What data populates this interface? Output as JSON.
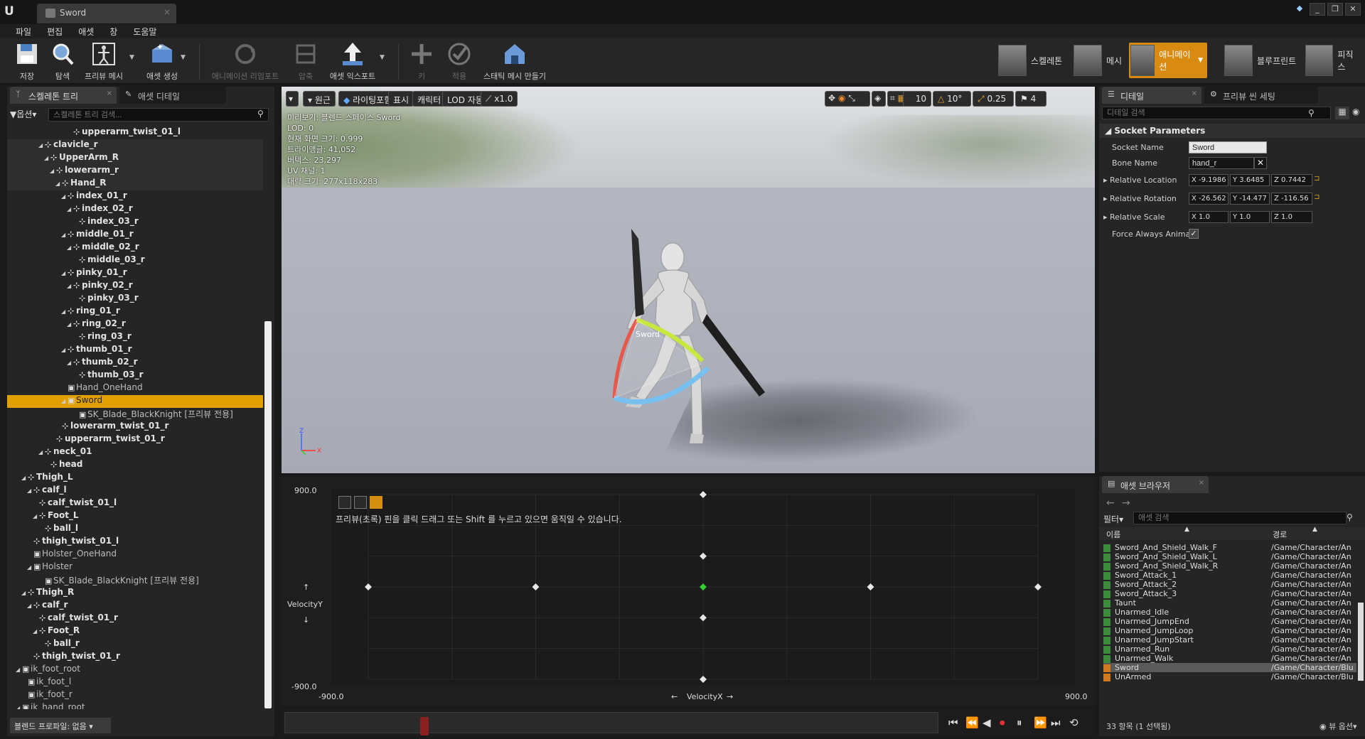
{
  "title": {
    "tab": "Sword"
  },
  "menu": [
    "파일",
    "편집",
    "애셋",
    "창",
    "도움말"
  ],
  "toolbar": {
    "buttons": [
      {
        "label": "저장",
        "icon": "save-icon"
      },
      {
        "label": "탐색",
        "icon": "browse-icon"
      },
      {
        "label": "프리뷰 메시",
        "icon": "preview-mesh-icon"
      },
      {
        "label": "애셋 생성",
        "icon": "create-asset-icon"
      },
      {
        "label": "애니메이션 리임포트",
        "icon": "reimport-icon"
      },
      {
        "label": "압축",
        "icon": "compression-icon"
      },
      {
        "label": "애셋 익스포트",
        "icon": "export-asset-icon"
      },
      {
        "label": "키",
        "icon": "key-icon"
      },
      {
        "label": "적용",
        "icon": "apply-icon"
      },
      {
        "label": "스태틱 메시 만들기",
        "icon": "make-static-mesh-icon"
      }
    ],
    "modes": [
      "스켈레톤",
      "메시",
      "애니메이션",
      "블루프린트",
      "피직스"
    ]
  },
  "left": {
    "tabs": [
      "스켈레톤 트리",
      "애셋 디테일"
    ],
    "options": "옵션",
    "search_placeholder": "스켈레톤 트리 검색...",
    "tree": [
      {
        "label": "upperarm_twist_01_l",
        "indent": 10,
        "tri": "",
        "bold": true
      },
      {
        "label": "clavicle_r",
        "indent": 5,
        "tri": "◢",
        "bold": true
      },
      {
        "label": "UpperArm_R",
        "indent": 6,
        "tri": "◢",
        "bold": true
      },
      {
        "label": "lowerarm_r",
        "indent": 7,
        "tri": "◢",
        "bold": true
      },
      {
        "label": "Hand_R",
        "indent": 8,
        "tri": "◢",
        "bold": true
      },
      {
        "label": "index_01_r",
        "indent": 9,
        "tri": "◢",
        "bold": true
      },
      {
        "label": "index_02_r",
        "indent": 10,
        "tri": "◢",
        "bold": true
      },
      {
        "label": "index_03_r",
        "indent": 11,
        "tri": "",
        "bold": true
      },
      {
        "label": "middle_01_r",
        "indent": 9,
        "tri": "◢",
        "bold": true
      },
      {
        "label": "middle_02_r",
        "indent": 10,
        "tri": "◢",
        "bold": true
      },
      {
        "label": "middle_03_r",
        "indent": 11,
        "tri": "",
        "bold": true
      },
      {
        "label": "pinky_01_r",
        "indent": 9,
        "tri": "◢",
        "bold": true
      },
      {
        "label": "pinky_02_r",
        "indent": 10,
        "tri": "◢",
        "bold": true
      },
      {
        "label": "pinky_03_r",
        "indent": 11,
        "tri": "",
        "bold": true
      },
      {
        "label": "ring_01_r",
        "indent": 9,
        "tri": "◢",
        "bold": true
      },
      {
        "label": "ring_02_r",
        "indent": 10,
        "tri": "◢",
        "bold": true
      },
      {
        "label": "ring_03_r",
        "indent": 11,
        "tri": "",
        "bold": true
      },
      {
        "label": "thumb_01_r",
        "indent": 9,
        "tri": "◢",
        "bold": true
      },
      {
        "label": "thumb_02_r",
        "indent": 10,
        "tri": "◢",
        "bold": true
      },
      {
        "label": "thumb_03_r",
        "indent": 11,
        "tri": "",
        "bold": true
      },
      {
        "label": "Hand_OneHand",
        "indent": 9,
        "tri": "",
        "bold": false
      },
      {
        "label": "Sword",
        "indent": 9,
        "tri": "◢",
        "bold": false,
        "selected": true
      },
      {
        "label": "SK_Blade_BlackKnight [프리뷰 전용]",
        "indent": 11,
        "tri": "",
        "bold": false
      },
      {
        "label": "lowerarm_twist_01_r",
        "indent": 8,
        "tri": "",
        "bold": true
      },
      {
        "label": "upperarm_twist_01_r",
        "indent": 7,
        "tri": "",
        "bold": true
      },
      {
        "label": "neck_01",
        "indent": 5,
        "tri": "◢",
        "bold": true
      },
      {
        "label": "head",
        "indent": 6,
        "tri": "",
        "bold": true
      },
      {
        "label": "Thigh_L",
        "indent": 2,
        "tri": "◢",
        "bold": true
      },
      {
        "label": "calf_l",
        "indent": 3,
        "tri": "◢",
        "bold": true
      },
      {
        "label": "calf_twist_01_l",
        "indent": 4,
        "tri": "",
        "bold": true
      },
      {
        "label": "Foot_L",
        "indent": 4,
        "tri": "◢",
        "bold": true
      },
      {
        "label": "ball_l",
        "indent": 5,
        "tri": "",
        "bold": true
      },
      {
        "label": "thigh_twist_01_l",
        "indent": 3,
        "tri": "",
        "bold": true
      },
      {
        "label": "Holster_OneHand",
        "indent": 3,
        "tri": "",
        "bold": false
      },
      {
        "label": "Holster",
        "indent": 3,
        "tri": "◢",
        "bold": false
      },
      {
        "label": "SK_Blade_BlackKnight [프리뷰 전용]",
        "indent": 5,
        "tri": "",
        "bold": false
      },
      {
        "label": "Thigh_R",
        "indent": 2,
        "tri": "◢",
        "bold": true
      },
      {
        "label": "calf_r",
        "indent": 3,
        "tri": "◢",
        "bold": true
      },
      {
        "label": "calf_twist_01_r",
        "indent": 4,
        "tri": "",
        "bold": true
      },
      {
        "label": "Foot_R",
        "indent": 4,
        "tri": "◢",
        "bold": true
      },
      {
        "label": "ball_r",
        "indent": 5,
        "tri": "",
        "bold": true
      },
      {
        "label": "thigh_twist_01_r",
        "indent": 3,
        "tri": "",
        "bold": true
      },
      {
        "label": "ik_foot_root",
        "indent": 1,
        "tri": "◢",
        "bold": false
      },
      {
        "label": "ik_foot_l",
        "indent": 2,
        "tri": "",
        "bold": false
      },
      {
        "label": "ik_foot_r",
        "indent": 2,
        "tri": "",
        "bold": false
      },
      {
        "label": "ik_hand_root",
        "indent": 1,
        "tri": "◢",
        "bold": false
      }
    ],
    "preview_profile": "블렌드 프로파일: 없음"
  },
  "viewport": {
    "buttons": [
      "원근",
      "라이팅포함",
      "표시",
      "캐릭터",
      "LOD 자동",
      "x1.0"
    ],
    "snap": {
      "grid": "10",
      "angle": "10°",
      "scale": "0.25",
      "speed": "4"
    },
    "info": [
      "미리보기: 블렌드 스페이스 Sword",
      "LOD: 0",
      "현재 화면 크기: 0.999",
      "트라이앵글: 41,052",
      "버텍스: 23,297",
      "UV 채널: 1",
      "대략 크기: 277x118x283"
    ],
    "socket_label": "Sword",
    "axis": {
      "z": "Z",
      "x": "X"
    }
  },
  "blendspace": {
    "hint": "프리뷰(초록) 핀을 클릭 드래그 또는 Shift 를 누르고 있으면 움직일 수 있습니다.",
    "y_axis": {
      "label": "VelocityY",
      "max": "900.0",
      "min": "-900.0"
    },
    "x_axis": {
      "label": "VelocityX",
      "min": "-900.0",
      "max": "900.0"
    },
    "samples": [
      [
        0,
        900
      ],
      [
        0,
        300
      ],
      [
        -900,
        0
      ],
      [
        -450,
        0
      ],
      [
        450,
        0
      ],
      [
        900,
        0
      ],
      [
        0,
        -300
      ],
      [
        0,
        -900
      ]
    ],
    "preview_pin": [
      0,
      0
    ]
  },
  "details": {
    "tabs": [
      "디테일",
      "프리뷰 씬 세팅"
    ],
    "search_placeholder": "디테일 검색",
    "section": "Socket Parameters",
    "socket_name_label": "Socket Name",
    "socket_name": "Sword",
    "bone_name_label": "Bone Name",
    "bone_name": "hand_r",
    "location_label": "Relative Location",
    "location": {
      "x": "-9.1986",
      "y": "3.6485",
      "z": "0.7442"
    },
    "rotation_label": "Relative Rotation",
    "rotation": {
      "x": "-26.562",
      "y": "-14.477",
      "z": "-116.56"
    },
    "scale_label": "Relative Scale",
    "scale": {
      "x": "1.0",
      "y": "1.0",
      "z": "1.0"
    },
    "force_label": "Force Always Animate",
    "force_checked": true
  },
  "assets": {
    "tab": "애셋 브라우저",
    "filter": "필터",
    "search_placeholder": "애셋 검색",
    "col_name": "이름",
    "col_path": "경로",
    "rows": [
      {
        "name": "Sword_And_Shield_Walk_F",
        "path": "/Game/Character/An"
      },
      {
        "name": "Sword_And_Shield_Walk_L",
        "path": "/Game/Character/An"
      },
      {
        "name": "Sword_And_Shield_Walk_R",
        "path": "/Game/Character/An"
      },
      {
        "name": "Sword_Attack_1",
        "path": "/Game/Character/An"
      },
      {
        "name": "Sword_Attack_2",
        "path": "/Game/Character/An"
      },
      {
        "name": "Sword_Attack_3",
        "path": "/Game/Character/An"
      },
      {
        "name": "Taunt",
        "path": "/Game/Character/An"
      },
      {
        "name": "Unarmed_Idle",
        "path": "/Game/Character/An"
      },
      {
        "name": "Unarmed_JumpEnd",
        "path": "/Game/Character/An"
      },
      {
        "name": "Unarmed_JumpLoop",
        "path": "/Game/Character/An"
      },
      {
        "name": "Unarmed_JumpStart",
        "path": "/Game/Character/An"
      },
      {
        "name": "Unarmed_Run",
        "path": "/Game/Character/An"
      },
      {
        "name": "Unarmed_Walk",
        "path": "/Game/Character/An"
      },
      {
        "name": "Sword",
        "path": "/Game/Character/Blu",
        "selected": true,
        "orange": true
      },
      {
        "name": "UnArmed",
        "path": "/Game/Character/Blu",
        "orange": true
      }
    ],
    "count": "33 항목 (1 선택됨)",
    "view_options": "뷰 옵션"
  }
}
